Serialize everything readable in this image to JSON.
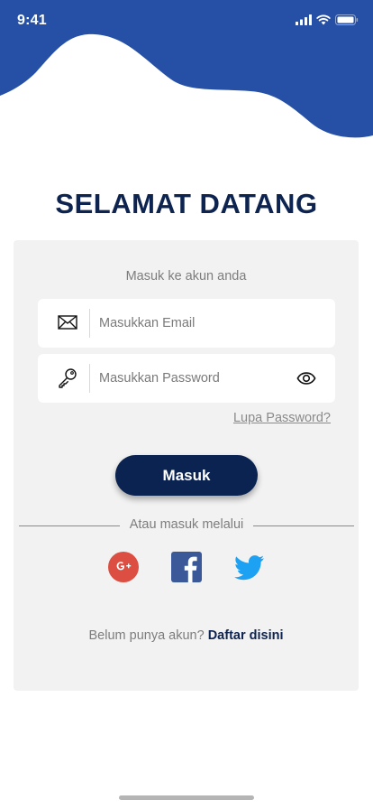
{
  "status_bar": {
    "time": "9:41",
    "icons": [
      "cellular-signal-icon",
      "wifi-icon",
      "battery-icon"
    ]
  },
  "header": {
    "wave_color": "#2550a6"
  },
  "title": "SELAMAT DATANG",
  "form": {
    "subtitle": "Masuk ke akun anda",
    "email": {
      "icon": "envelope-icon",
      "placeholder": "Masukkan Email",
      "value": ""
    },
    "password": {
      "icon": "key-icon",
      "placeholder": "Masukkan Password",
      "value": "",
      "toggle_icon": "eye-icon"
    },
    "forgot_label": "Lupa Password?",
    "login_label": "Masuk",
    "divider_label": "Atau masuk melalui",
    "social": [
      {
        "name": "google",
        "icon": "google-plus-icon",
        "color": "#dc4e41"
      },
      {
        "name": "facebook",
        "icon": "facebook-icon",
        "color": "#3b5998"
      },
      {
        "name": "twitter",
        "icon": "twitter-icon",
        "color": "#1da1f2"
      }
    ],
    "signup_prompt": "Belum punya akun?",
    "signup_link": "Daftar disini"
  },
  "colors": {
    "primary": "#0a2350",
    "card_bg": "#f2f2f2",
    "muted_text": "#7d7d7d"
  }
}
